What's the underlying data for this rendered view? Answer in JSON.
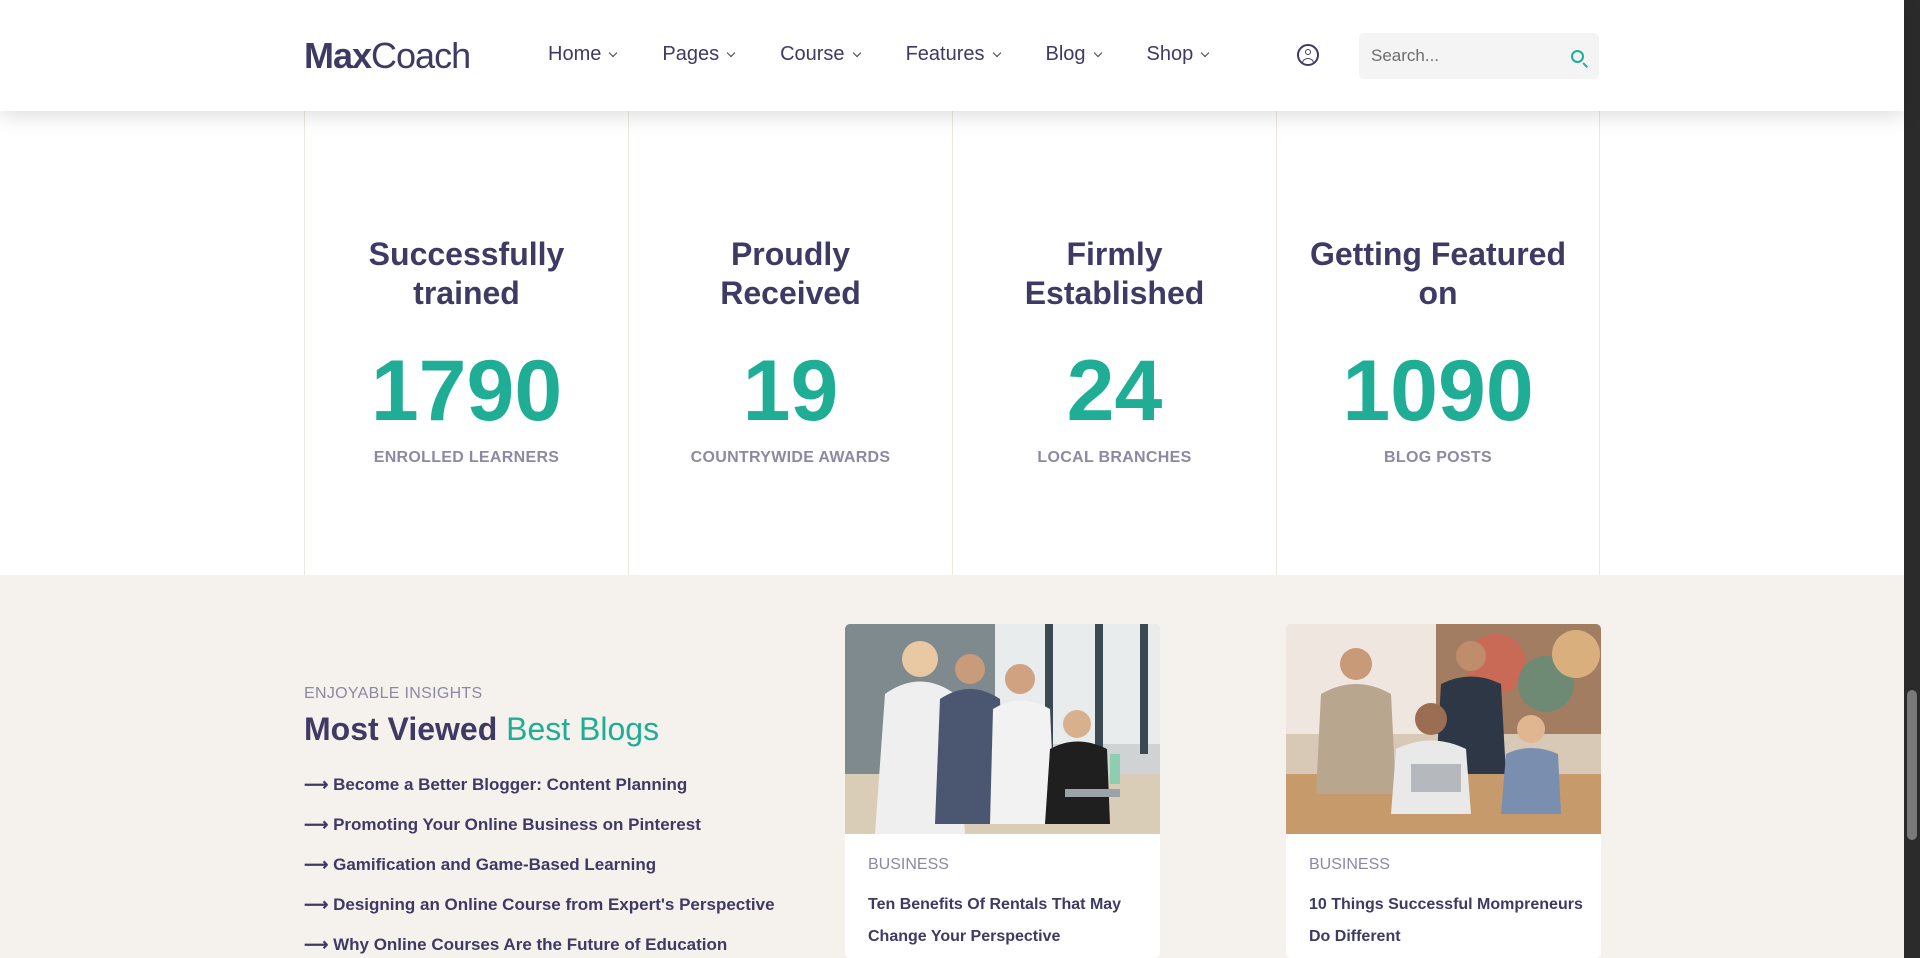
{
  "header": {
    "logo_bold": "Max",
    "logo_light": "Coach",
    "nav": [
      {
        "label": "Home"
      },
      {
        "label": "Pages"
      },
      {
        "label": "Course"
      },
      {
        "label": "Features"
      },
      {
        "label": "Blog"
      },
      {
        "label": "Shop"
      }
    ],
    "search_placeholder": "Search..."
  },
  "stats": [
    {
      "heading": "Successfully trained",
      "number": "1790",
      "label": "ENROLLED LEARNERS"
    },
    {
      "heading": "Proudly Received",
      "number": "19",
      "label": "COUNTRYWIDE AWARDS"
    },
    {
      "heading": "Firmly Established",
      "number": "24",
      "label": "LOCAL BRANCHES"
    },
    {
      "heading": "Getting Featured on",
      "number": "1090",
      "label": "BLOG POSTS"
    }
  ],
  "blog": {
    "eyebrow": "ENJOYABLE INSIGHTS",
    "title_main": "Most Viewed",
    "title_accent": "Best Blogs",
    "links": [
      "⟶ Become a Better Blogger: Content Planning",
      "⟶ Promoting Your Online Business on Pinterest",
      "⟶ Gamification and Game-Based Learning",
      "⟶ Designing an Online Course from Expert's Perspective",
      "⟶ Why Online Courses Are the Future of Education"
    ],
    "cards": [
      {
        "tag": "BUSINESS",
        "title": "Ten Benefits Of Rentals That May Change Your Perspective"
      },
      {
        "tag": "BUSINESS",
        "title": "10 Things Successful Mompreneurs Do Different"
      }
    ]
  },
  "colors": {
    "primary": "#3f3a64",
    "accent": "#20ad96",
    "muted": "#8c89a2",
    "section_bg": "#f5f1ed"
  }
}
